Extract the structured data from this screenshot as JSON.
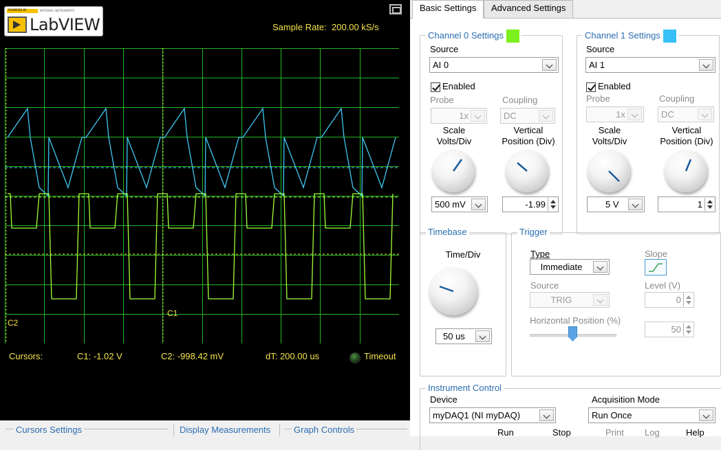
{
  "header": {
    "logo_text": "LabVIEW",
    "logo_powered_by": "POWERED BY",
    "logo_ni": "NATIONAL INSTRUMENTS",
    "sample_rate_label": "Sample Rate:",
    "sample_rate_value": "200.00 kS/s"
  },
  "graph": {
    "cursor_c1_label": "C1",
    "cursor_c2_label": "C2",
    "trace_colors": {
      "channel0": "#a6ff3a",
      "channel1": "#3fc8f4"
    },
    "background": "#000000",
    "grid_color": "#22b822"
  },
  "cursors": {
    "label": "Cursors:",
    "c1": "C1:  -1.02 V",
    "c2": "C2:  -998.42 mV",
    "dt": "dT:  200.00 us",
    "timeout": "Timeout"
  },
  "bottom_tabs": [
    "Cursors Settings",
    "Display Measurements",
    "Graph Controls"
  ],
  "tabs": {
    "basic": "Basic Settings",
    "advanced": "Advanced Settings"
  },
  "ch0": {
    "title": "Channel 0 Settings",
    "swatch": "#7cf01a",
    "source_label": "Source",
    "source": "AI 0",
    "enabled": "Enabled",
    "probe_label": "Probe",
    "probe": "1x",
    "coupling_label": "Coupling",
    "coupling": "DC",
    "scale_label": "Scale\nVolts/Div",
    "vpos_label": "Vertical\nPosition (Div)",
    "scale": "500 mV",
    "vpos": "-1.99"
  },
  "ch1": {
    "title": "Channel 1 Settings",
    "swatch": "#36c0f6",
    "source_label": "Source",
    "source": "AI 1",
    "enabled": "Enabled",
    "probe_label": "Probe",
    "probe": "1x",
    "coupling_label": "Coupling",
    "coupling": "DC",
    "scale_label": "Scale\nVolts/Div",
    "vpos_label": "Vertical\nPosition (Div)",
    "scale": "5 V",
    "vpos": "1"
  },
  "timebase": {
    "title": "Timebase",
    "label": "Time/Div",
    "value": "50 us"
  },
  "trigger": {
    "title": "Trigger",
    "type_label": "Type",
    "type": "Immediate",
    "slope_label": "Slope",
    "source_label": "Source",
    "source": "TRIG",
    "level_label": "Level (V)",
    "level": "0",
    "hpos_label": "Horizontal Position (%)",
    "hpos": "50"
  },
  "instrument": {
    "title": "Instrument Control",
    "device_label": "Device",
    "device": "myDAQ1 (NI myDAQ)",
    "mode_label": "Acquisition Mode",
    "mode": "Run Once"
  },
  "actions": {
    "run": "Run",
    "stop": "Stop",
    "print": "Print",
    "log": "Log",
    "help": "Help"
  }
}
